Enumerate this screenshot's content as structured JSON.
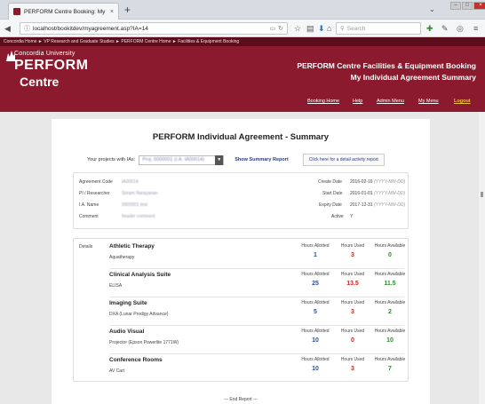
{
  "browser": {
    "tab_title": "PERFORM Centre Booking: My Indiv",
    "tab_close": "×",
    "new_tab": "+",
    "url": "localhost/bookitdev/myagreement.asp?IA=14",
    "search_placeholder": "Search"
  },
  "site": {
    "breadcrumb": "Concordia Home  ►  VP Research and Graduate Studies  ►  PERFORM Centre Home  ►  Facilities & Equipment Booking",
    "logo_university": "Concordia University",
    "logo_perform": "PERFORM",
    "logo_centre": "Centre",
    "title_line1": "PERFORM Centre Facilities & Equipment Booking",
    "title_line2": "My Individual Agreement Summary",
    "menu": {
      "booking_home": "Booking Home",
      "help": "Help",
      "admin_menu": "Admin Menu",
      "my_menu": "My Menu",
      "logout": "Logout"
    }
  },
  "summary": {
    "page_title": "PERFORM Individual Agreement - Summary",
    "projects_label": "Your projects with IAs:",
    "project_selected": "Proj. 0000001 (I.A. IA00014)",
    "show_summary": "Show Summary Report",
    "detail_button": "Click here for a detail activity report",
    "agreement": {
      "code_label": "Agreement Code",
      "code_value": "IA00014",
      "pi_label": "PI / Researcher",
      "pi_value": "Sriram Narayanan",
      "ia_name_label": "I.A. Name",
      "ia_name_value": "0000001 test",
      "comment_label": "Comment",
      "comment_value": "header comment",
      "create_label": "Create Date",
      "create_value": "2016-02-16",
      "start_label": "Start Date",
      "start_value": "2016-01-01",
      "expiry_label": "Expiry Date",
      "expiry_value": "2017-12-31",
      "date_hint": "(YYYY-MM-DD)",
      "active_label": "Active",
      "active_value": "Y"
    },
    "details_label": "Details",
    "col_allotted": "Hours Allotted",
    "col_used": "Hours Used",
    "col_available": "Hours Available",
    "items": [
      {
        "name": "Athletic Therapy",
        "sub": "Aquatherapy",
        "allotted": "1",
        "used": "3",
        "available": "0"
      },
      {
        "name": "Clinical Analysis Suite",
        "sub": "ELISA",
        "allotted": "25",
        "used": "13.5",
        "available": "11.5"
      },
      {
        "name": "Imaging Suite",
        "sub": "DXA (Lunar Prodigy Advance)",
        "allotted": "5",
        "used": "3",
        "available": "2"
      },
      {
        "name": "Audio Visual",
        "sub": "Projector (Epson Powerlite 1771W)",
        "allotted": "10",
        "used": "0",
        "available": "10"
      },
      {
        "name": "Conference Rooms",
        "sub": "AV Cart",
        "allotted": "10",
        "used": "3",
        "available": "7"
      }
    ],
    "end_report": "--- End Report ---"
  },
  "colors": {
    "brand": "#8b1a2e",
    "allotted": "#2d4fa0",
    "used": "#c42424",
    "available": "#2e8b2e"
  }
}
